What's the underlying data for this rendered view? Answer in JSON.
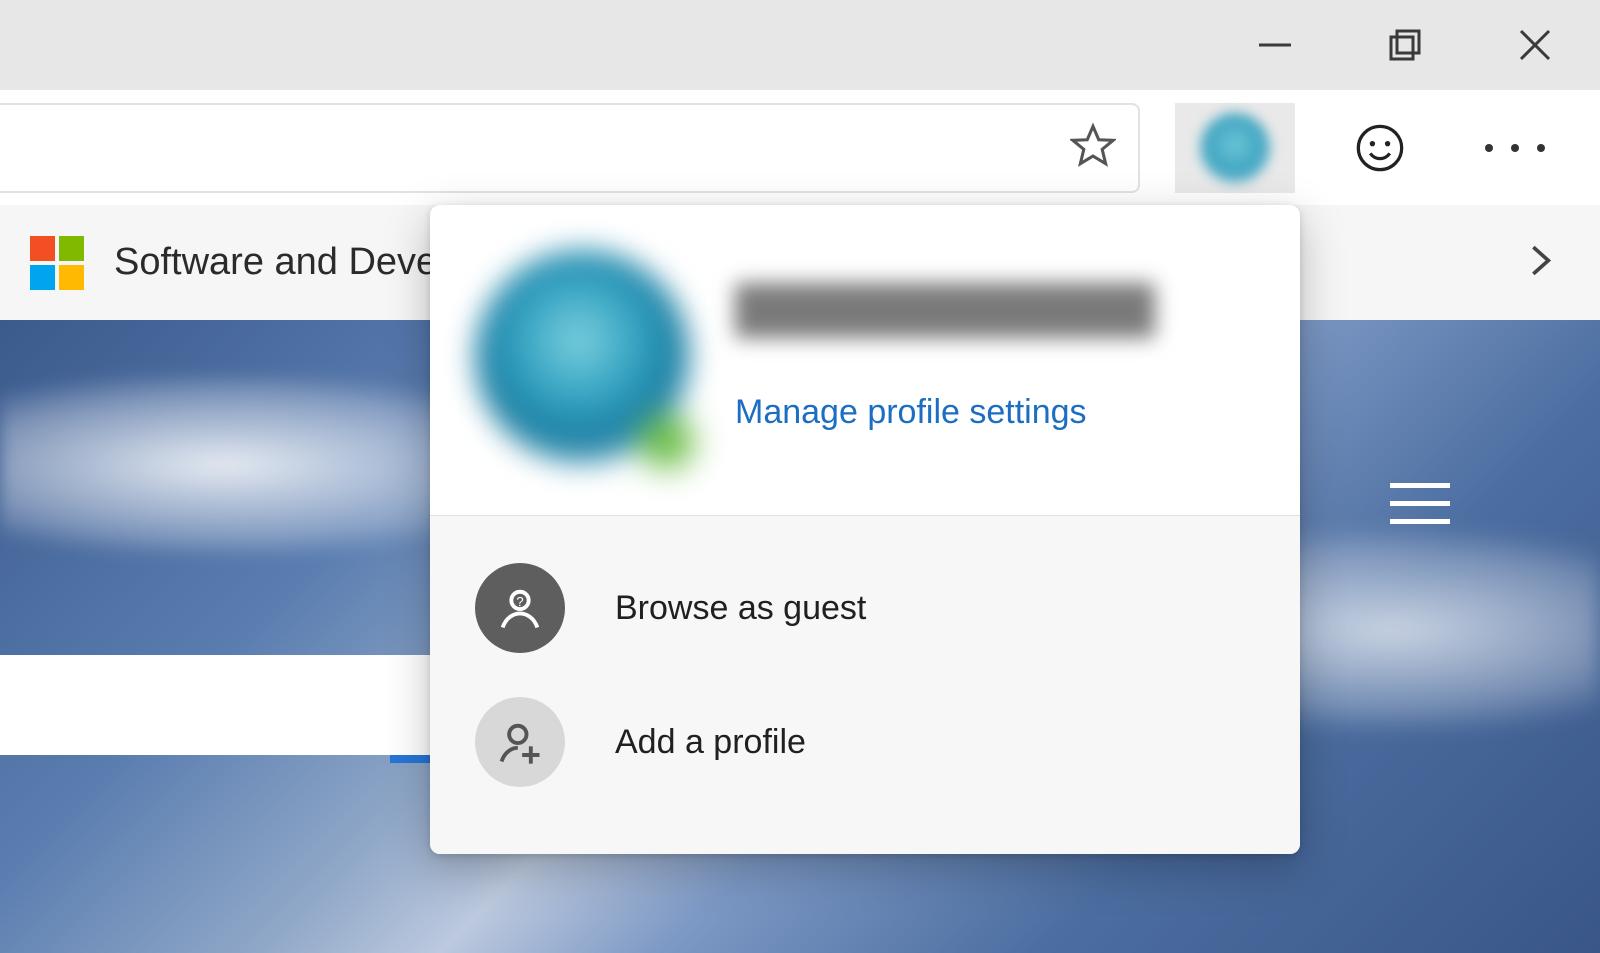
{
  "window_controls": {
    "minimize": "minimize",
    "maximize": "maximize",
    "close": "close"
  },
  "toolbar": {
    "star_title": "Add this page to favorites",
    "profile_title": "Profile",
    "feedback_title": "Send feedback",
    "more_title": "Settings and more"
  },
  "bookmarks": {
    "item1": "Software and Devel…",
    "overflow_title": "More favorites"
  },
  "page": {
    "menu_title": "Menu"
  },
  "profile_flyout": {
    "manage_link": "Manage profile settings",
    "guest": "Browse as guest",
    "add": "Add a profile"
  }
}
